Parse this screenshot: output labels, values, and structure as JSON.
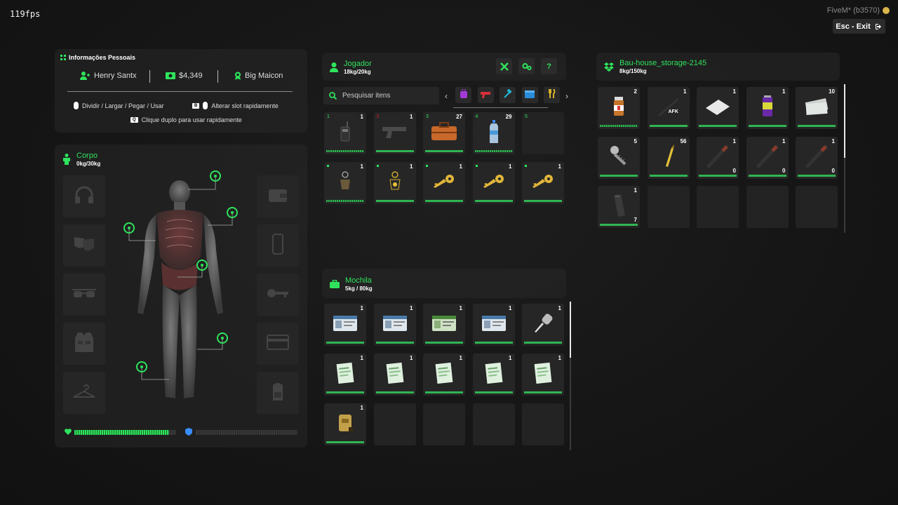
{
  "hud": {
    "fps": "119fps",
    "client": "FiveM* (b3570)",
    "exit_label": "Esc - Exit"
  },
  "colors": {
    "accent": "#2fe35c",
    "panel": "#282828",
    "slot": "#262626",
    "shield": "#3a8dff"
  },
  "personal": {
    "title": "Informações Pessoais",
    "name": "Henry Santx",
    "money": "$4,349",
    "job": "Big Maicon",
    "hint1": "Dividir / Largar / Pegar / Usar",
    "hint2": "Alterar slot rapidamente",
    "hint3": "Clique duplo para usar rapidamente",
    "kbd_b": "B",
    "kbd_q": "Q"
  },
  "body": {
    "title": "Corpo",
    "weight": "0kg/30kg",
    "health_fraction": 0.93,
    "armor_fraction": 0.0,
    "left_slots": [
      "headphones-icon",
      "mask-icon",
      "glasses-icon",
      "vest-icon",
      "hanger-icon"
    ],
    "right_slots": [
      "wallet-icon",
      "phone-icon",
      "key-icon",
      "card-icon",
      "backpack-icon"
    ]
  },
  "player": {
    "title": "Jogador",
    "weight": "18kg/20kg",
    "search_placeholder": "Pesquisar itens",
    "categories": [
      "bag-icon",
      "gun-icon",
      "hammer-icon",
      "box-icon",
      "food-icon"
    ],
    "slots": [
      {
        "idx": "1",
        "count": "1",
        "item": "radio",
        "bar": "dotted"
      },
      {
        "idx": "2",
        "count": "1",
        "item": "pistol",
        "bar": "solid",
        "red": true
      },
      {
        "idx": "3",
        "count": "27",
        "item": "suitcase",
        "bar": "solid"
      },
      {
        "idx": "4",
        "count": "29",
        "item": "water",
        "bar": "dotted"
      },
      {
        "idx": "5",
        "count": "",
        "item": "",
        "bar": ""
      },
      {
        "idx": "",
        "count": "1",
        "item": "keychain",
        "bar": "dotted",
        "dot": true
      },
      {
        "idx": "",
        "count": "1",
        "item": "keychain-gold",
        "bar": "solid",
        "dot": true
      },
      {
        "idx": "",
        "count": "1",
        "item": "key",
        "bar": "solid",
        "dot": true
      },
      {
        "idx": "",
        "count": "1",
        "item": "key",
        "bar": "solid",
        "dot": true
      },
      {
        "idx": "",
        "count": "1",
        "item": "key",
        "bar": "solid",
        "dot": true
      }
    ]
  },
  "backpack": {
    "title": "Mochila",
    "weight": "5kg / 80kg",
    "slots": [
      {
        "count": "1",
        "item": "id-card",
        "bar": "solid"
      },
      {
        "count": "1",
        "item": "id-card",
        "bar": "solid"
      },
      {
        "count": "1",
        "item": "id-card-green",
        "bar": "solid"
      },
      {
        "count": "1",
        "item": "id-card",
        "bar": "solid"
      },
      {
        "count": "1",
        "item": "car-key",
        "bar": "solid"
      },
      {
        "count": "1",
        "item": "document",
        "bar": "solid"
      },
      {
        "count": "1",
        "item": "document",
        "bar": "solid"
      },
      {
        "count": "1",
        "item": "document",
        "bar": "solid"
      },
      {
        "count": "1",
        "item": "document",
        "bar": "solid"
      },
      {
        "count": "1",
        "item": "document",
        "bar": "solid"
      },
      {
        "count": "1",
        "item": "golden-bag",
        "bar": "solid"
      }
    ]
  },
  "storage": {
    "title": "Bau-house_storage-2145",
    "weight": "8kg/150kg",
    "slots": [
      {
        "count": "2",
        "item": "pill-bottle",
        "bar": "dotted"
      },
      {
        "count": "1",
        "item": "stick",
        "bar": "solid",
        "afk": "AFK"
      },
      {
        "count": "1",
        "item": "paper",
        "bar": "solid"
      },
      {
        "count": "1",
        "item": "can",
        "bar": "solid"
      },
      {
        "count": "10",
        "item": "cash",
        "bar": "solid"
      },
      {
        "count": "5",
        "item": "screw",
        "bar": "solid"
      },
      {
        "count": "56",
        "item": "bullet",
        "bar": "solid"
      },
      {
        "count": "1",
        "item": "bat",
        "bar": "solid",
        "sub": "0"
      },
      {
        "count": "1",
        "item": "bat",
        "bar": "solid",
        "sub": "0"
      },
      {
        "count": "1",
        "item": "bat",
        "bar": "solid",
        "sub": "0"
      },
      {
        "count": "1",
        "item": "magazine",
        "bar": "solid",
        "sub": "7"
      }
    ]
  }
}
